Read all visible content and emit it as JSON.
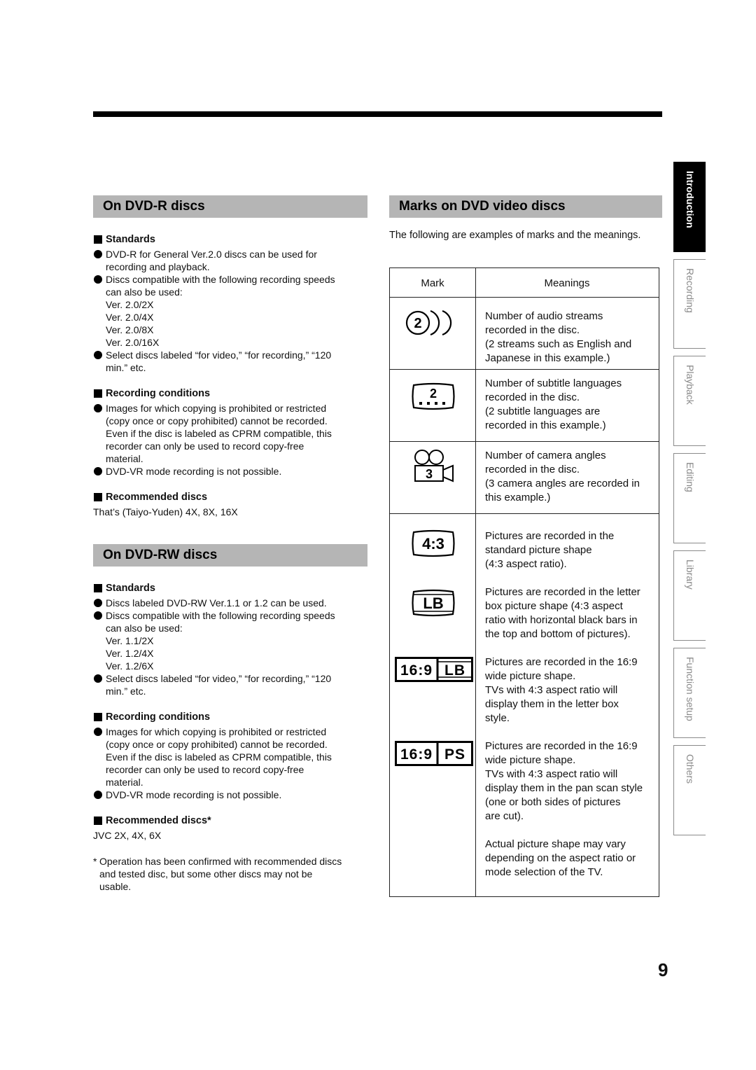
{
  "page_number": "9",
  "tabs": [
    {
      "label": "Introduction",
      "active": true
    },
    {
      "label": "Recording",
      "active": false
    },
    {
      "label": "Playback",
      "active": false
    },
    {
      "label": "Editing",
      "active": false
    },
    {
      "label": "Library",
      "active": false
    },
    {
      "label": "Function setup",
      "active": false
    },
    {
      "label": "Others",
      "active": false
    }
  ],
  "dvd_r": {
    "title": "On DVD-R discs",
    "standards": {
      "heading": "Standards",
      "bullet1": [
        "DVD-R for General Ver.2.0 discs can be used for",
        "recording and playback."
      ],
      "bullet2": [
        "Discs compatible with the following recording speeds",
        "can also be used:"
      ],
      "versions": [
        "Ver. 2.0/2X",
        "Ver. 2.0/4X",
        "Ver. 2.0/8X",
        "Ver. 2.0/16X"
      ],
      "bullet3": [
        "Select discs labeled “for video,” “for recording,” “120",
        "min.” etc."
      ]
    },
    "recording_conditions": {
      "heading": "Recording conditions",
      "bullet1": [
        "Images for which copying is prohibited or restricted",
        "(copy once or copy prohibited) cannot be recorded.",
        "Even if the disc is labeled as CPRM compatible, this",
        "recorder can only be used to record copy-free",
        "material."
      ],
      "bullet2": "DVD-VR mode recording is not possible."
    },
    "recommended": {
      "heading": "Recommended discs",
      "text": "That’s (Taiyo-Yuden) 4X, 8X, 16X"
    }
  },
  "dvd_rw": {
    "title": "On DVD-RW discs",
    "standards": {
      "heading": "Standards",
      "bullet1": "Discs labeled DVD-RW Ver.1.1 or 1.2 can be used.",
      "bullet2": [
        "Discs compatible with the following recording speeds",
        "can also be used:"
      ],
      "versions": [
        "Ver. 1.1/2X",
        "Ver. 1.2/4X",
        "Ver. 1.2/6X"
      ],
      "bullet3": [
        "Select discs labeled “for video,” “for recording,” “120",
        "min.” etc."
      ]
    },
    "recording_conditions": {
      "heading": "Recording conditions",
      "bullet1": [
        "Images for which copying is prohibited or restricted",
        "(copy once or copy prohibited) cannot be recorded.",
        "Even if the disc is labeled as CPRM compatible, this",
        "recorder can only be used to record copy-free",
        "material."
      ],
      "bullet2": "DVD-VR mode recording is not possible."
    },
    "recommended": {
      "heading": "Recommended discs*",
      "text": "JVC 2X, 4X, 6X"
    },
    "footnote": [
      "Operation has been confirmed with recommended discs",
      "and tested disc, but some other discs may not be",
      "usable."
    ]
  },
  "marks": {
    "title": "Marks on DVD video discs",
    "intro": "The following are examples of marks and the meanings.",
    "col_mark": "Mark",
    "col_meanings": "Meanings",
    "rows": [
      {
        "icon": "audio-streams-icon",
        "symbol": "2",
        "lines": [
          "Number of audio streams",
          "recorded in the disc.",
          "(2 streams such as English and",
          "Japanese in this example.)"
        ]
      },
      {
        "icon": "subtitle-languages-icon",
        "symbol": "2",
        "lines": [
          "Number of subtitle languages",
          "recorded in the disc.",
          "(2 subtitle languages are",
          "recorded in this example.)"
        ]
      },
      {
        "icon": "camera-angles-icon",
        "symbol": "3",
        "lines": [
          "Number of camera angles",
          "recorded in the disc.",
          "(3 camera angles are recorded in",
          "this example.)"
        ]
      },
      {
        "icon": "aspect-4-3-icon",
        "symbol": "4:3",
        "lines": [
          "Pictures are recorded in the",
          "standard picture shape",
          "(4:3 aspect ratio)."
        ]
      },
      {
        "icon": "letterbox-icon",
        "symbol": "LB",
        "lines": [
          "Pictures are recorded in the letter",
          "box picture shape (4:3 aspect",
          "ratio with horizontal black bars in",
          "the top and bottom of pictures)."
        ]
      },
      {
        "icon": "wide-letterbox-icon",
        "symbol_left": "16:9",
        "symbol_right": "LB",
        "lines": [
          "Pictures are recorded in the 16:9",
          "wide picture shape.",
          "TVs with 4:3 aspect ratio will",
          "display them in the letter box",
          "style."
        ]
      },
      {
        "icon": "wide-panscan-icon",
        "symbol_left": "16:9",
        "symbol_right": "PS",
        "lines": [
          "Pictures are recorded in the 16:9",
          "wide picture shape.",
          "TVs with 4:3 aspect ratio will",
          "display them in the pan scan style",
          "(one or both sides of pictures",
          "are cut)."
        ]
      }
    ],
    "closing_note": [
      "Actual picture shape may vary",
      "depending on the aspect ratio or",
      "mode selection of the TV."
    ]
  }
}
